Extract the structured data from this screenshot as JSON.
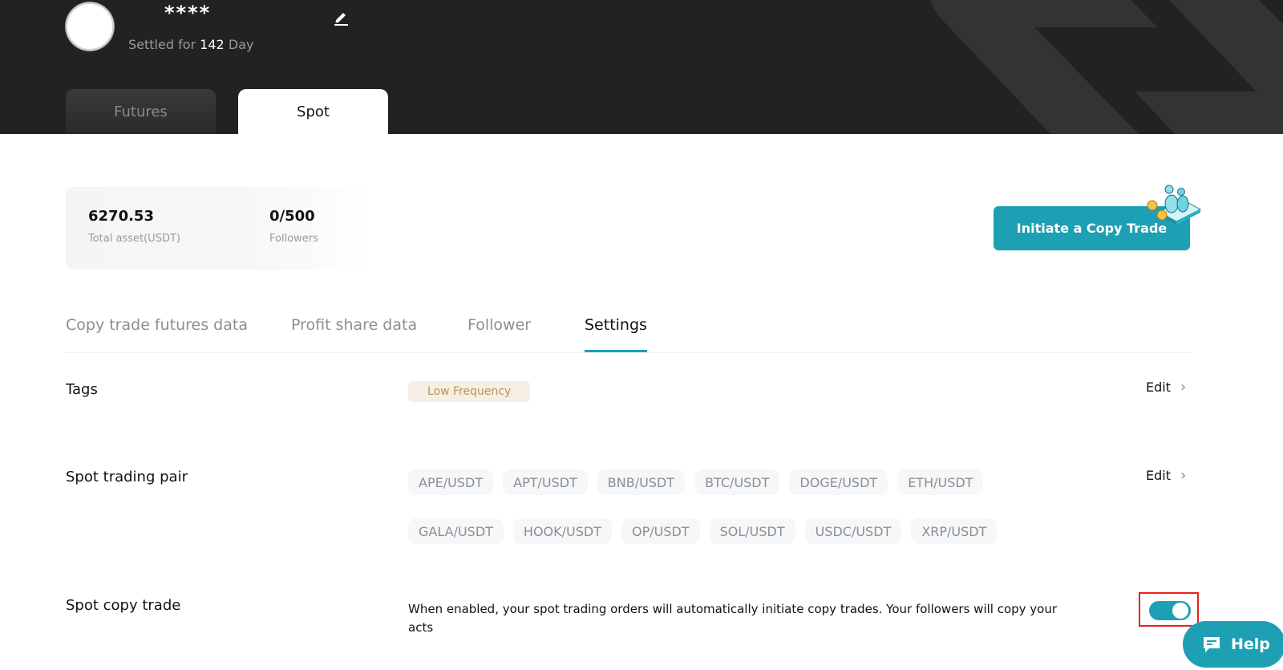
{
  "profile": {
    "nickname": "****",
    "settled_prefix": "Settled for",
    "settled_days": "142",
    "settled_suffix": "Day"
  },
  "market_tabs": [
    {
      "label": "Futures",
      "active": false
    },
    {
      "label": "Spot",
      "active": true
    }
  ],
  "summary": {
    "total_asset_value": "6270.53",
    "total_asset_label": "Total asset(USDT)",
    "followers_value": "0/500",
    "followers_label": "Followers"
  },
  "initiate_button": {
    "label": "Initiate a Copy Trade"
  },
  "sub_tabs": [
    {
      "label": "Copy trade futures data",
      "active": false
    },
    {
      "label": "Profit share data",
      "active": false
    },
    {
      "label": "Follower",
      "active": false
    },
    {
      "label": "Settings",
      "active": true
    }
  ],
  "settings": {
    "tags": {
      "label": "Tags",
      "values": [
        "Low Frequency"
      ],
      "edit_label": "Edit"
    },
    "trading_pairs": {
      "label": "Spot trading pair",
      "edit_label": "Edit",
      "pairs": [
        "APE/USDT",
        "APT/USDT",
        "BNB/USDT",
        "BTC/USDT",
        "DOGE/USDT",
        "ETH/USDT",
        "GALA/USDT",
        "HOOK/USDT",
        "OP/USDT",
        "SOL/USDT",
        "USDC/USDT",
        "XRP/USDT"
      ]
    },
    "spot_copy_trade": {
      "label": "Spot copy trade",
      "description": "When enabled, your spot trading orders will automatically initiate copy trades. Your followers will copy your acts",
      "enabled": true
    }
  },
  "help_button": {
    "label": "Help"
  },
  "colors": {
    "accent": "#1ea0b4",
    "header_bg": "#222222",
    "tag_bg": "#f5efe4",
    "tag_text": "#b8955a",
    "highlight_border": "#e8231e"
  }
}
